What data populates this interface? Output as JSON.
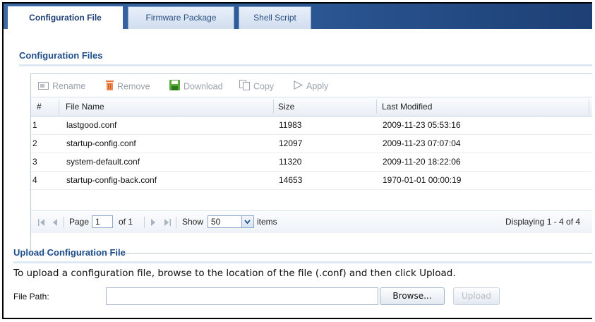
{
  "tabs": [
    {
      "label": "Configuration File",
      "active": true
    },
    {
      "label": "Firmware Package",
      "active": false
    },
    {
      "label": "Shell Script",
      "active": false
    }
  ],
  "config_section": {
    "title": "Configuration Files",
    "toolbar": {
      "rename": "Rename",
      "remove": "Remove",
      "download": "Download",
      "copy": "Copy",
      "apply": "Apply"
    },
    "columns": [
      "#",
      "File Name",
      "Size",
      "Last Modified"
    ],
    "rows": [
      {
        "num": "1",
        "name": "lastgood.conf",
        "size": "11983",
        "modified": "2009-11-23 05:53:16"
      },
      {
        "num": "2",
        "name": "startup-config.conf",
        "size": "12097",
        "modified": "2009-11-23 07:07:04"
      },
      {
        "num": "3",
        "name": "system-default.conf",
        "size": "11320",
        "modified": "2009-11-20 18:22:06"
      },
      {
        "num": "4",
        "name": "startup-config-back.conf",
        "size": "14653",
        "modified": "1970-01-01 00:00:19"
      }
    ],
    "pager": {
      "page_label": "Page",
      "page_value": "1",
      "of_label": "of 1",
      "show_label": "Show",
      "show_value": "50",
      "items_label": "items",
      "displaying": "Displaying 1 - 4 of 4"
    }
  },
  "upload_section": {
    "title": "Upload Configuration File",
    "instructions": "To upload a configuration file, browse to the location of the file (.conf) and then click Upload.",
    "file_path_label": "File Path:",
    "file_path_value": "",
    "browse_label": "Browse...",
    "upload_label": "Upload"
  },
  "colors": {
    "tab_bar": "#2d5a97",
    "section_title": "#1f4f8a",
    "disabled_text": "#9aa3ad"
  }
}
